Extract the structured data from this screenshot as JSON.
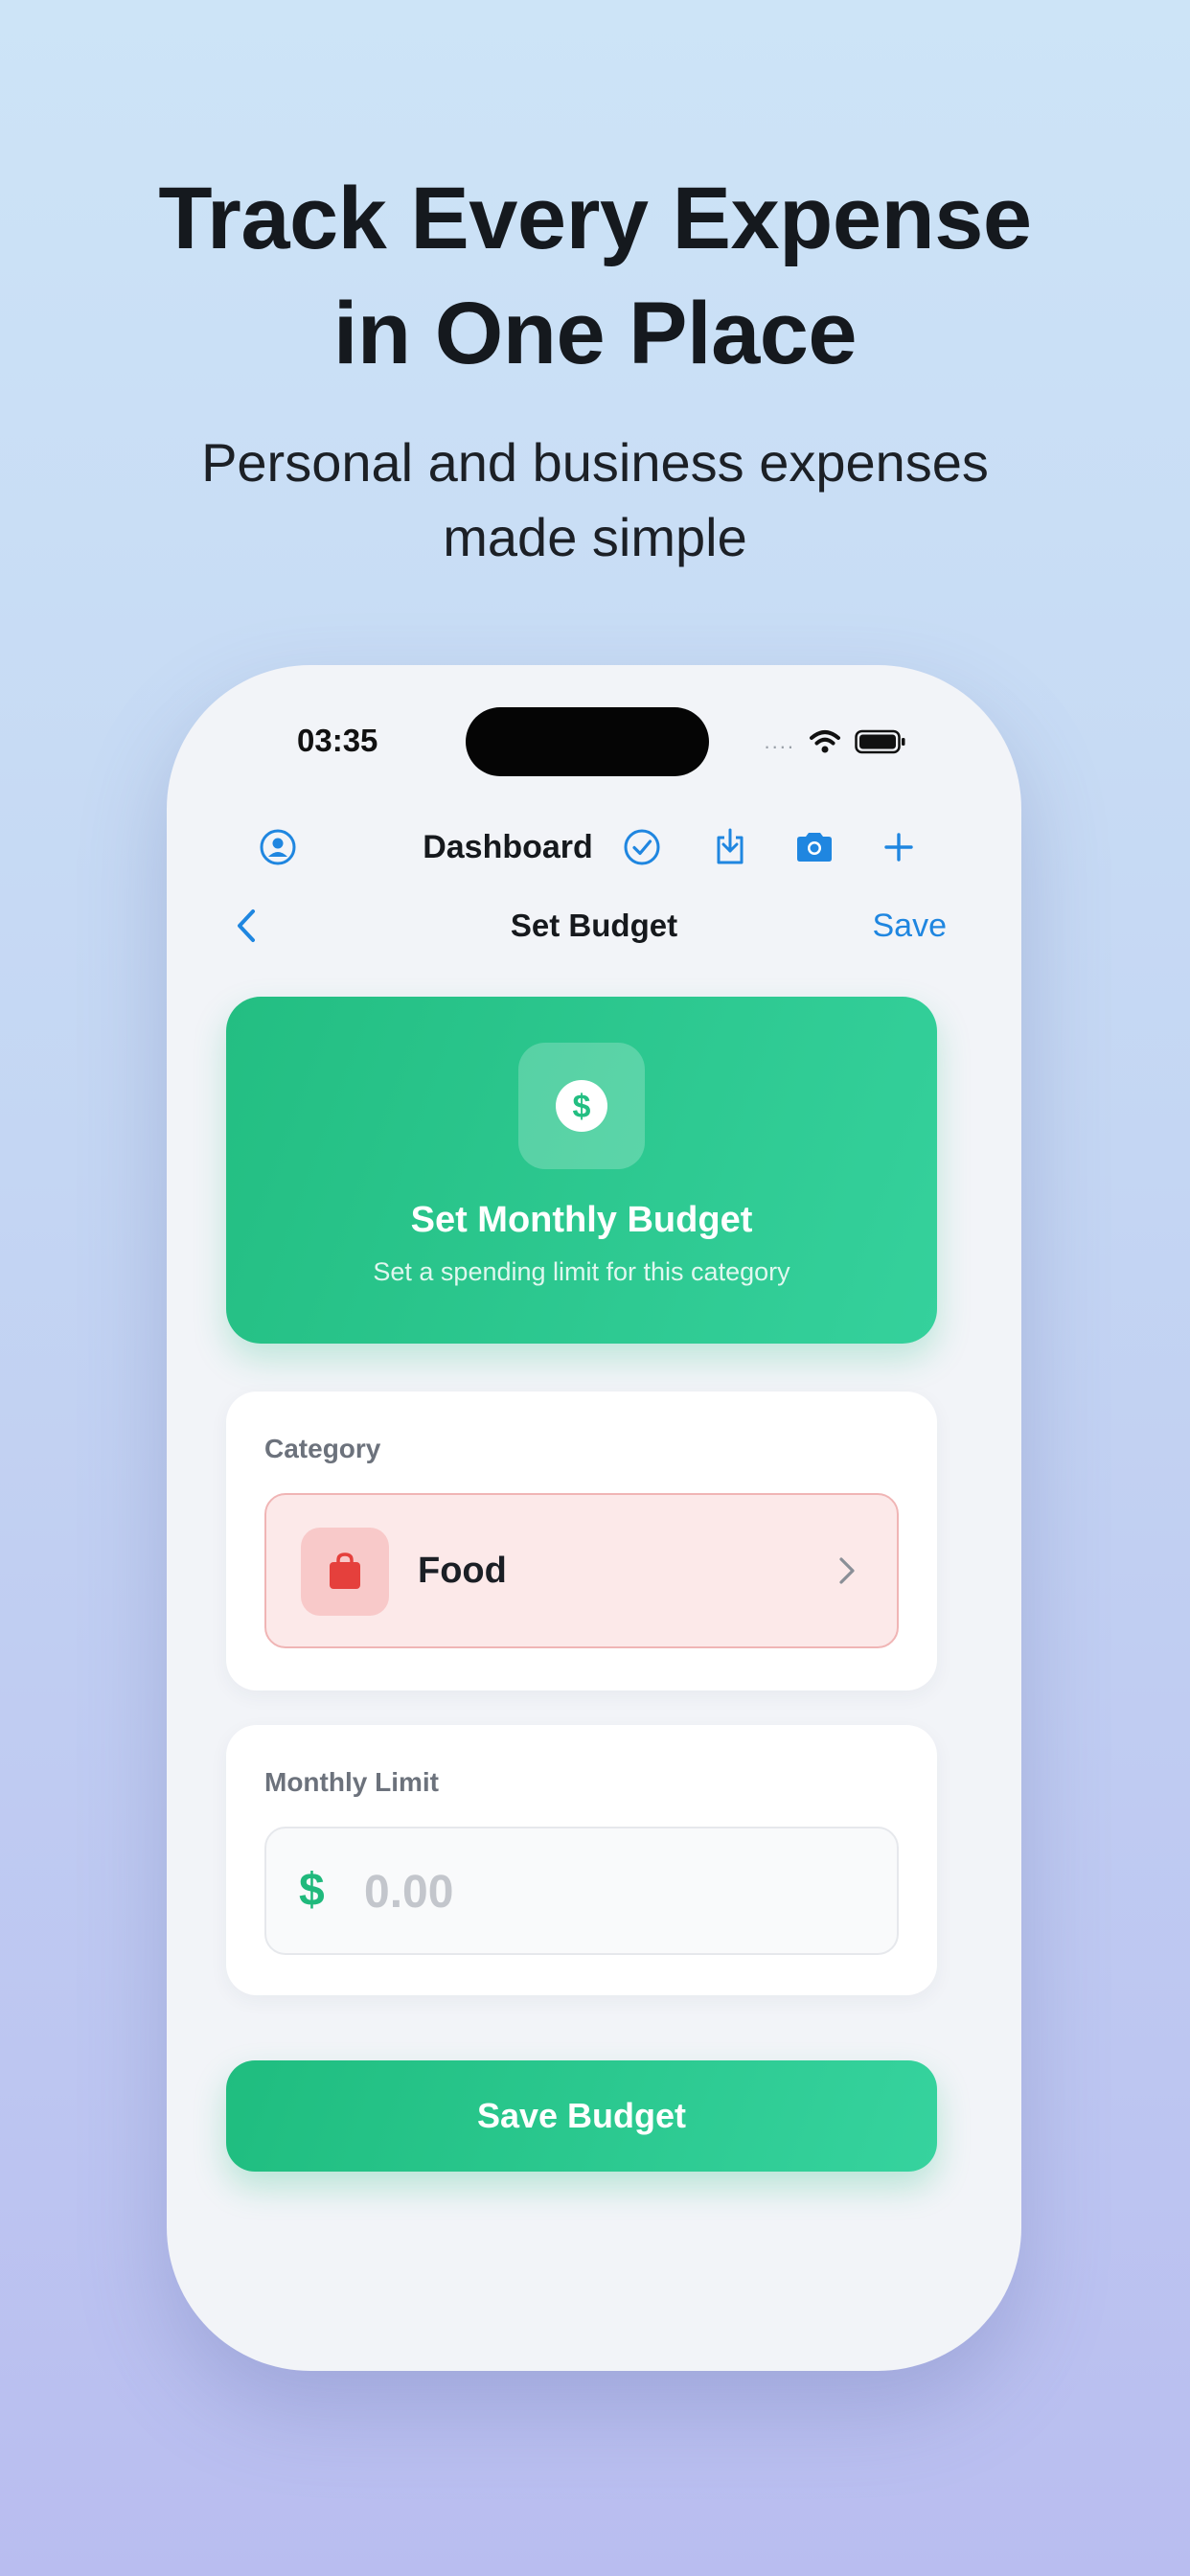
{
  "marketing": {
    "headline_line1": "Track Every Expense",
    "headline_line2": "in One Place",
    "subhead_line1": "Personal and business expenses",
    "subhead_line2": "made simple"
  },
  "status_bar": {
    "time": "03:35",
    "signal": "....",
    "icons": [
      "wifi-icon",
      "battery-icon"
    ]
  },
  "toolbar": {
    "title": "Dashboard",
    "icons": [
      "profile-icon",
      "checkmark-circle-icon",
      "download-icon",
      "camera-icon",
      "plus-icon"
    ]
  },
  "nav": {
    "back_icon": "chevron-left-icon",
    "title": "Set Budget",
    "save_label": "Save"
  },
  "hero": {
    "icon": "dollar-circle-icon",
    "title": "Set Monthly Budget",
    "subtitle": "Set a spending limit for this category"
  },
  "category": {
    "label": "Category",
    "selected": "Food",
    "icon": "shopping-bag-icon"
  },
  "monthly_limit": {
    "label": "Monthly Limit",
    "currency_symbol": "$",
    "value": "",
    "placeholder": "0.00"
  },
  "save_budget_label": "Save Budget",
  "colors": {
    "accent_green": "#23be82",
    "link_blue": "#1f86e0",
    "category_red": "#e5403c"
  }
}
